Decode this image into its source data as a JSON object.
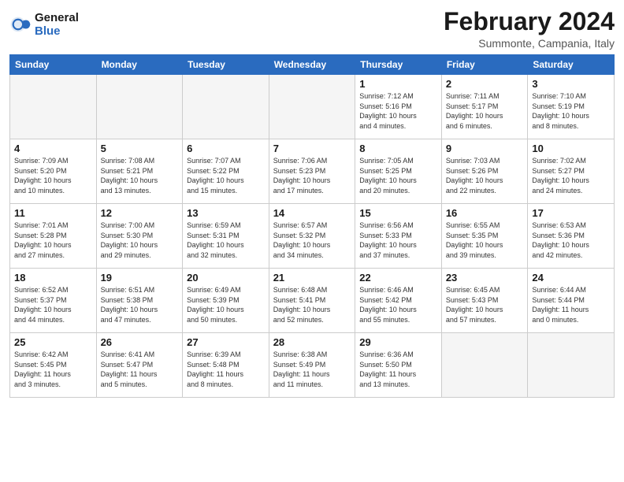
{
  "logo": {
    "text_general": "General",
    "text_blue": "Blue"
  },
  "title": "February 2024",
  "subtitle": "Summonte, Campania, Italy",
  "days_of_week": [
    "Sunday",
    "Monday",
    "Tuesday",
    "Wednesday",
    "Thursday",
    "Friday",
    "Saturday"
  ],
  "weeks": [
    [
      {
        "day": "",
        "info": ""
      },
      {
        "day": "",
        "info": ""
      },
      {
        "day": "",
        "info": ""
      },
      {
        "day": "",
        "info": ""
      },
      {
        "day": "1",
        "info": "Sunrise: 7:12 AM\nSunset: 5:16 PM\nDaylight: 10 hours\nand 4 minutes."
      },
      {
        "day": "2",
        "info": "Sunrise: 7:11 AM\nSunset: 5:17 PM\nDaylight: 10 hours\nand 6 minutes."
      },
      {
        "day": "3",
        "info": "Sunrise: 7:10 AM\nSunset: 5:19 PM\nDaylight: 10 hours\nand 8 minutes."
      }
    ],
    [
      {
        "day": "4",
        "info": "Sunrise: 7:09 AM\nSunset: 5:20 PM\nDaylight: 10 hours\nand 10 minutes."
      },
      {
        "day": "5",
        "info": "Sunrise: 7:08 AM\nSunset: 5:21 PM\nDaylight: 10 hours\nand 13 minutes."
      },
      {
        "day": "6",
        "info": "Sunrise: 7:07 AM\nSunset: 5:22 PM\nDaylight: 10 hours\nand 15 minutes."
      },
      {
        "day": "7",
        "info": "Sunrise: 7:06 AM\nSunset: 5:23 PM\nDaylight: 10 hours\nand 17 minutes."
      },
      {
        "day": "8",
        "info": "Sunrise: 7:05 AM\nSunset: 5:25 PM\nDaylight: 10 hours\nand 20 minutes."
      },
      {
        "day": "9",
        "info": "Sunrise: 7:03 AM\nSunset: 5:26 PM\nDaylight: 10 hours\nand 22 minutes."
      },
      {
        "day": "10",
        "info": "Sunrise: 7:02 AM\nSunset: 5:27 PM\nDaylight: 10 hours\nand 24 minutes."
      }
    ],
    [
      {
        "day": "11",
        "info": "Sunrise: 7:01 AM\nSunset: 5:28 PM\nDaylight: 10 hours\nand 27 minutes."
      },
      {
        "day": "12",
        "info": "Sunrise: 7:00 AM\nSunset: 5:30 PM\nDaylight: 10 hours\nand 29 minutes."
      },
      {
        "day": "13",
        "info": "Sunrise: 6:59 AM\nSunset: 5:31 PM\nDaylight: 10 hours\nand 32 minutes."
      },
      {
        "day": "14",
        "info": "Sunrise: 6:57 AM\nSunset: 5:32 PM\nDaylight: 10 hours\nand 34 minutes."
      },
      {
        "day": "15",
        "info": "Sunrise: 6:56 AM\nSunset: 5:33 PM\nDaylight: 10 hours\nand 37 minutes."
      },
      {
        "day": "16",
        "info": "Sunrise: 6:55 AM\nSunset: 5:35 PM\nDaylight: 10 hours\nand 39 minutes."
      },
      {
        "day": "17",
        "info": "Sunrise: 6:53 AM\nSunset: 5:36 PM\nDaylight: 10 hours\nand 42 minutes."
      }
    ],
    [
      {
        "day": "18",
        "info": "Sunrise: 6:52 AM\nSunset: 5:37 PM\nDaylight: 10 hours\nand 44 minutes."
      },
      {
        "day": "19",
        "info": "Sunrise: 6:51 AM\nSunset: 5:38 PM\nDaylight: 10 hours\nand 47 minutes."
      },
      {
        "day": "20",
        "info": "Sunrise: 6:49 AM\nSunset: 5:39 PM\nDaylight: 10 hours\nand 50 minutes."
      },
      {
        "day": "21",
        "info": "Sunrise: 6:48 AM\nSunset: 5:41 PM\nDaylight: 10 hours\nand 52 minutes."
      },
      {
        "day": "22",
        "info": "Sunrise: 6:46 AM\nSunset: 5:42 PM\nDaylight: 10 hours\nand 55 minutes."
      },
      {
        "day": "23",
        "info": "Sunrise: 6:45 AM\nSunset: 5:43 PM\nDaylight: 10 hours\nand 57 minutes."
      },
      {
        "day": "24",
        "info": "Sunrise: 6:44 AM\nSunset: 5:44 PM\nDaylight: 11 hours\nand 0 minutes."
      }
    ],
    [
      {
        "day": "25",
        "info": "Sunrise: 6:42 AM\nSunset: 5:45 PM\nDaylight: 11 hours\nand 3 minutes."
      },
      {
        "day": "26",
        "info": "Sunrise: 6:41 AM\nSunset: 5:47 PM\nDaylight: 11 hours\nand 5 minutes."
      },
      {
        "day": "27",
        "info": "Sunrise: 6:39 AM\nSunset: 5:48 PM\nDaylight: 11 hours\nand 8 minutes."
      },
      {
        "day": "28",
        "info": "Sunrise: 6:38 AM\nSunset: 5:49 PM\nDaylight: 11 hours\nand 11 minutes."
      },
      {
        "day": "29",
        "info": "Sunrise: 6:36 AM\nSunset: 5:50 PM\nDaylight: 11 hours\nand 13 minutes."
      },
      {
        "day": "",
        "info": ""
      },
      {
        "day": "",
        "info": ""
      }
    ]
  ]
}
